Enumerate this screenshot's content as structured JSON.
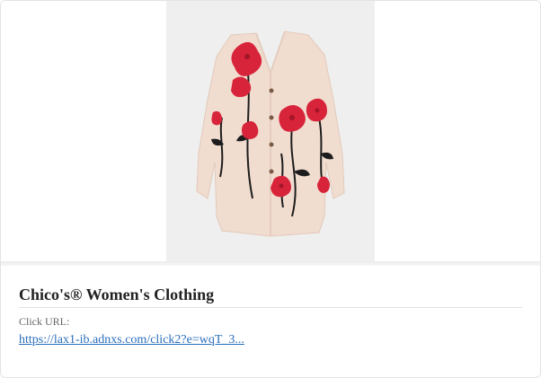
{
  "ad": {
    "image": {
      "subject": "cream cardigan with red poppy floral print",
      "background_color": "#efefef",
      "garment_color": "#f1ddd0",
      "flower_color": "#d8243a",
      "stem_color": "#1d1d1d"
    },
    "title": "Chico's® Women's Clothing",
    "click_label": "Click URL:",
    "click_url": "https://lax1-ib.adnxs.com/click2?e=wqT_3..."
  }
}
